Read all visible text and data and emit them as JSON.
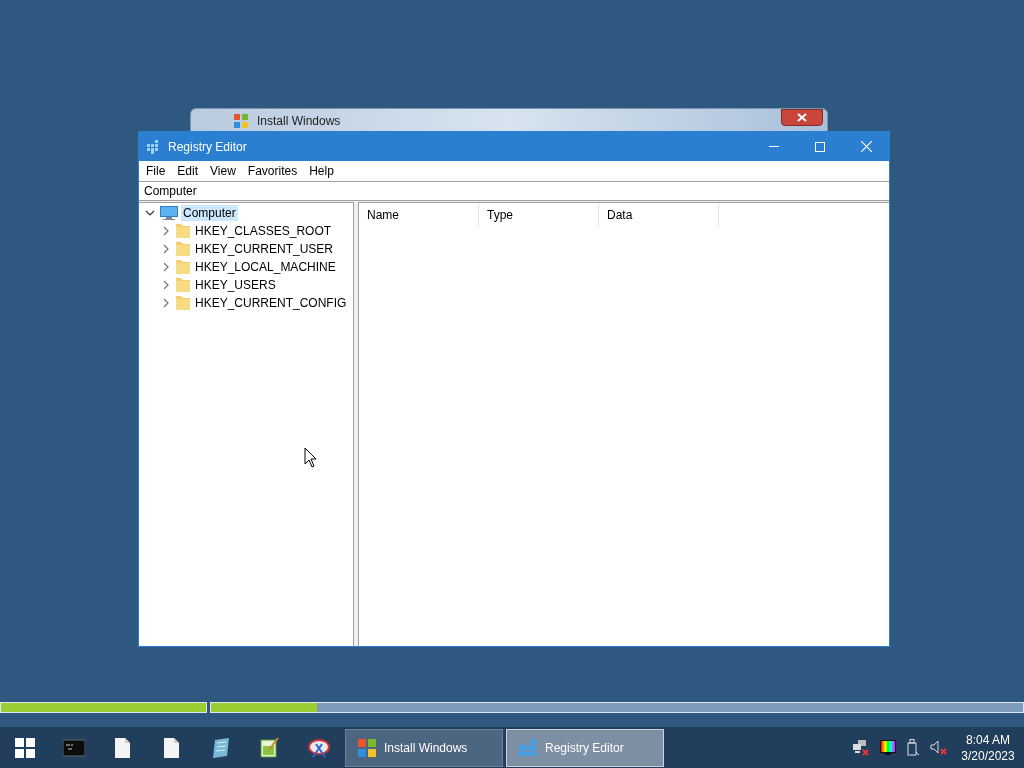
{
  "background_window": {
    "title": "Install Windows"
  },
  "window": {
    "title": "Registry Editor"
  },
  "menu": [
    "File",
    "Edit",
    "View",
    "Favorites",
    "Help"
  ],
  "address": "Computer",
  "tree": [
    {
      "label": "Computer",
      "kind": "computer",
      "expanded": true,
      "selected": true,
      "children": [
        {
          "label": "HKEY_CLASSES_ROOT",
          "kind": "folder",
          "expanded": false,
          "selected": false
        },
        {
          "label": "HKEY_CURRENT_USER",
          "kind": "folder",
          "expanded": false,
          "selected": false
        },
        {
          "label": "HKEY_LOCAL_MACHINE",
          "kind": "folder",
          "expanded": false,
          "selected": false
        },
        {
          "label": "HKEY_USERS",
          "kind": "folder",
          "expanded": false,
          "selected": false
        },
        {
          "label": "HKEY_CURRENT_CONFIG",
          "kind": "folder",
          "expanded": false,
          "selected": false
        }
      ]
    }
  ],
  "columns": [
    "Name",
    "Type",
    "Data"
  ],
  "progress": [
    {
      "level": 1
    },
    {
      "level": 0.13
    }
  ],
  "taskbar": {
    "pinned": [
      {
        "kind": "terminal"
      },
      {
        "kind": "file"
      },
      {
        "kind": "file"
      },
      {
        "kind": "notepad"
      },
      {
        "kind": "editor"
      },
      {
        "kind": "snipping"
      }
    ],
    "tasks": [
      {
        "label": "Install Windows",
        "kind": "setup",
        "selected": false
      },
      {
        "label": "Registry Editor",
        "kind": "registry",
        "selected": true
      }
    ],
    "clock": {
      "time": "8:04 AM",
      "date": "3/20/2023"
    }
  }
}
